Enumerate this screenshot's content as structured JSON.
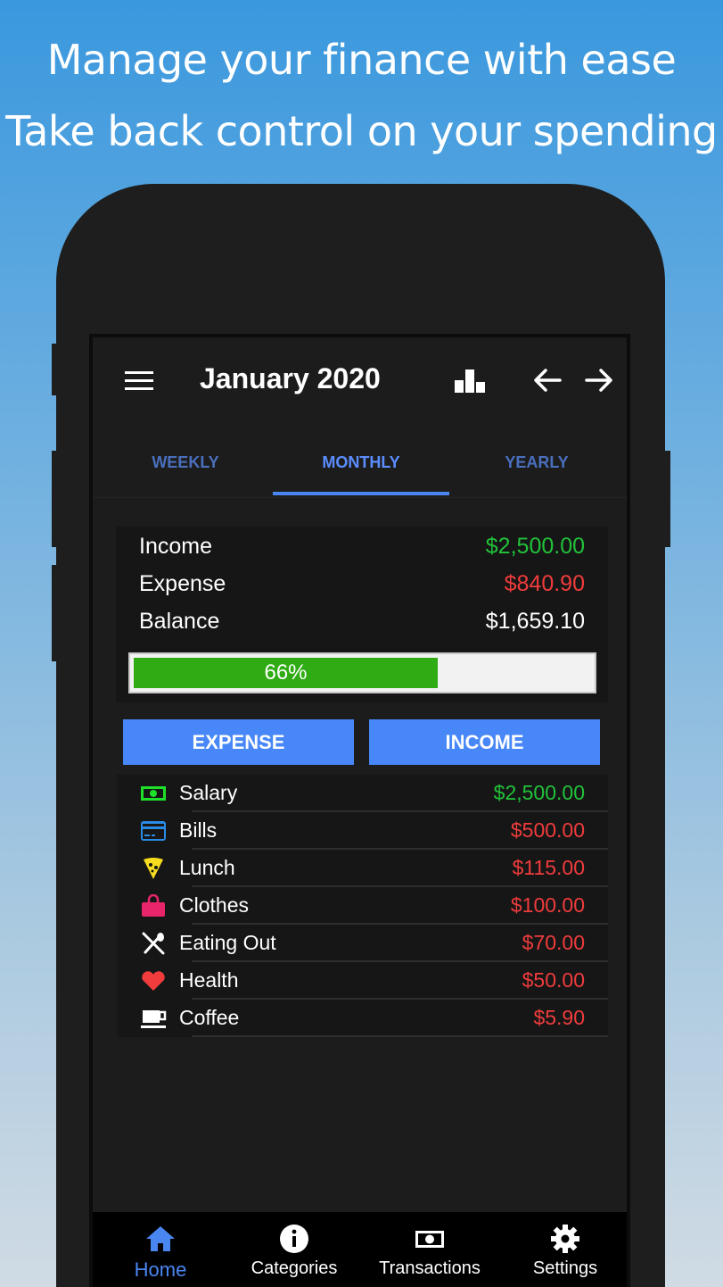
{
  "promo": {
    "line1": "Manage your finance with ease",
    "line2": "Take back control on your spending"
  },
  "appbar": {
    "title": "January 2020",
    "menu_icon": "menu-icon",
    "chart_icon": "bar-chart-icon",
    "prev_icon": "arrow-left-icon",
    "next_icon": "arrow-right-icon"
  },
  "tabs": [
    {
      "label": "WEEKLY",
      "active": false
    },
    {
      "label": "MONTHLY",
      "active": true
    },
    {
      "label": "YEARLY",
      "active": false
    }
  ],
  "summary": {
    "income_label": "Income",
    "income_value": "$2,500.00",
    "expense_label": "Expense",
    "expense_value": "$840.90",
    "balance_label": "Balance",
    "balance_value": "$1,659.10",
    "progress_text": "66%",
    "progress_fraction": 0.66
  },
  "buttons": {
    "expense": "EXPENSE",
    "income": "INCOME"
  },
  "categories": [
    {
      "name": "Salary",
      "amount": "$2,500.00",
      "icon": "cash-icon",
      "type": "income"
    },
    {
      "name": "Bills",
      "amount": "$500.00",
      "icon": "credit-card-icon",
      "type": "expense"
    },
    {
      "name": "Lunch",
      "amount": "$115.00",
      "icon": "pizza-icon",
      "type": "expense"
    },
    {
      "name": "Clothes",
      "amount": "$100.00",
      "icon": "shopping-bag-icon",
      "type": "expense"
    },
    {
      "name": "Eating Out",
      "amount": "$70.00",
      "icon": "utensils-icon",
      "type": "expense"
    },
    {
      "name": "Health",
      "amount": "$50.00",
      "icon": "heart-icon",
      "type": "expense"
    },
    {
      "name": "Coffee",
      "amount": "$5.90",
      "icon": "coffee-icon",
      "type": "expense"
    }
  ],
  "bottom_nav": [
    {
      "label": "Home",
      "icon": "home-icon",
      "active": true
    },
    {
      "label": "Categories",
      "icon": "info-icon",
      "active": false
    },
    {
      "label": "Transactions",
      "icon": "cash-icon",
      "active": false
    },
    {
      "label": "Settings",
      "icon": "gear-icon",
      "active": false
    }
  ],
  "colors": {
    "income": "#22c23a",
    "expense": "#f03c3c",
    "accent": "#4a86f2",
    "progress": "#2fab14"
  }
}
